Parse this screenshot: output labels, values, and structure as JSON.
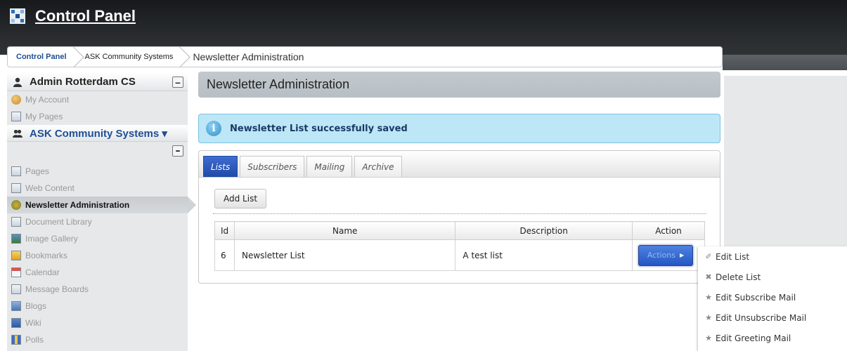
{
  "header": {
    "title": "Control Panel"
  },
  "breadcrumb": {
    "items": [
      "Control Panel",
      "ASK Community Systems",
      "Newsletter Administration"
    ]
  },
  "sidebar": {
    "user": {
      "name": "Admin Rotterdam CS",
      "items": [
        "My Account",
        "My Pages"
      ]
    },
    "group": {
      "name": "ASK Community Systems ▾",
      "items": [
        "Pages",
        "Web Content",
        "Newsletter Administration",
        "Document Library",
        "Image Gallery",
        "Bookmarks",
        "Calendar",
        "Message Boards",
        "Blogs",
        "Wiki",
        "Polls"
      ],
      "active": "Newsletter Administration"
    },
    "collapse_symbol": "–"
  },
  "main": {
    "title": "Newsletter Administration",
    "alert": "Newsletter List successfully saved",
    "info_glyph": "i",
    "tabs": [
      "Lists",
      "Subscribers",
      "Mailing",
      "Archive"
    ],
    "active_tab": "Lists",
    "add_button": "Add List",
    "table": {
      "headers": [
        "Id",
        "Name",
        "Description",
        "Action"
      ],
      "rows": [
        {
          "id": "6",
          "name": "Newsletter List",
          "description": "A test list",
          "action": "Actions"
        }
      ]
    }
  },
  "menu": {
    "items": [
      {
        "icon": "edit-icon",
        "glyph": "✐",
        "label": "Edit List"
      },
      {
        "icon": "delete-icon",
        "glyph": "✖",
        "label": "Delete List"
      },
      {
        "icon": "star-icon",
        "glyph": "★",
        "label": "Edit Subscribe Mail"
      },
      {
        "icon": "star-icon",
        "glyph": "★",
        "label": "Edit Unsubscribe Mail"
      },
      {
        "icon": "star-icon",
        "glyph": "★",
        "label": "Edit Greeting Mail"
      }
    ]
  },
  "colors": {
    "accent": "#2557c4",
    "alert_bg": "#bde7f7",
    "topbar": "#1f2124"
  }
}
